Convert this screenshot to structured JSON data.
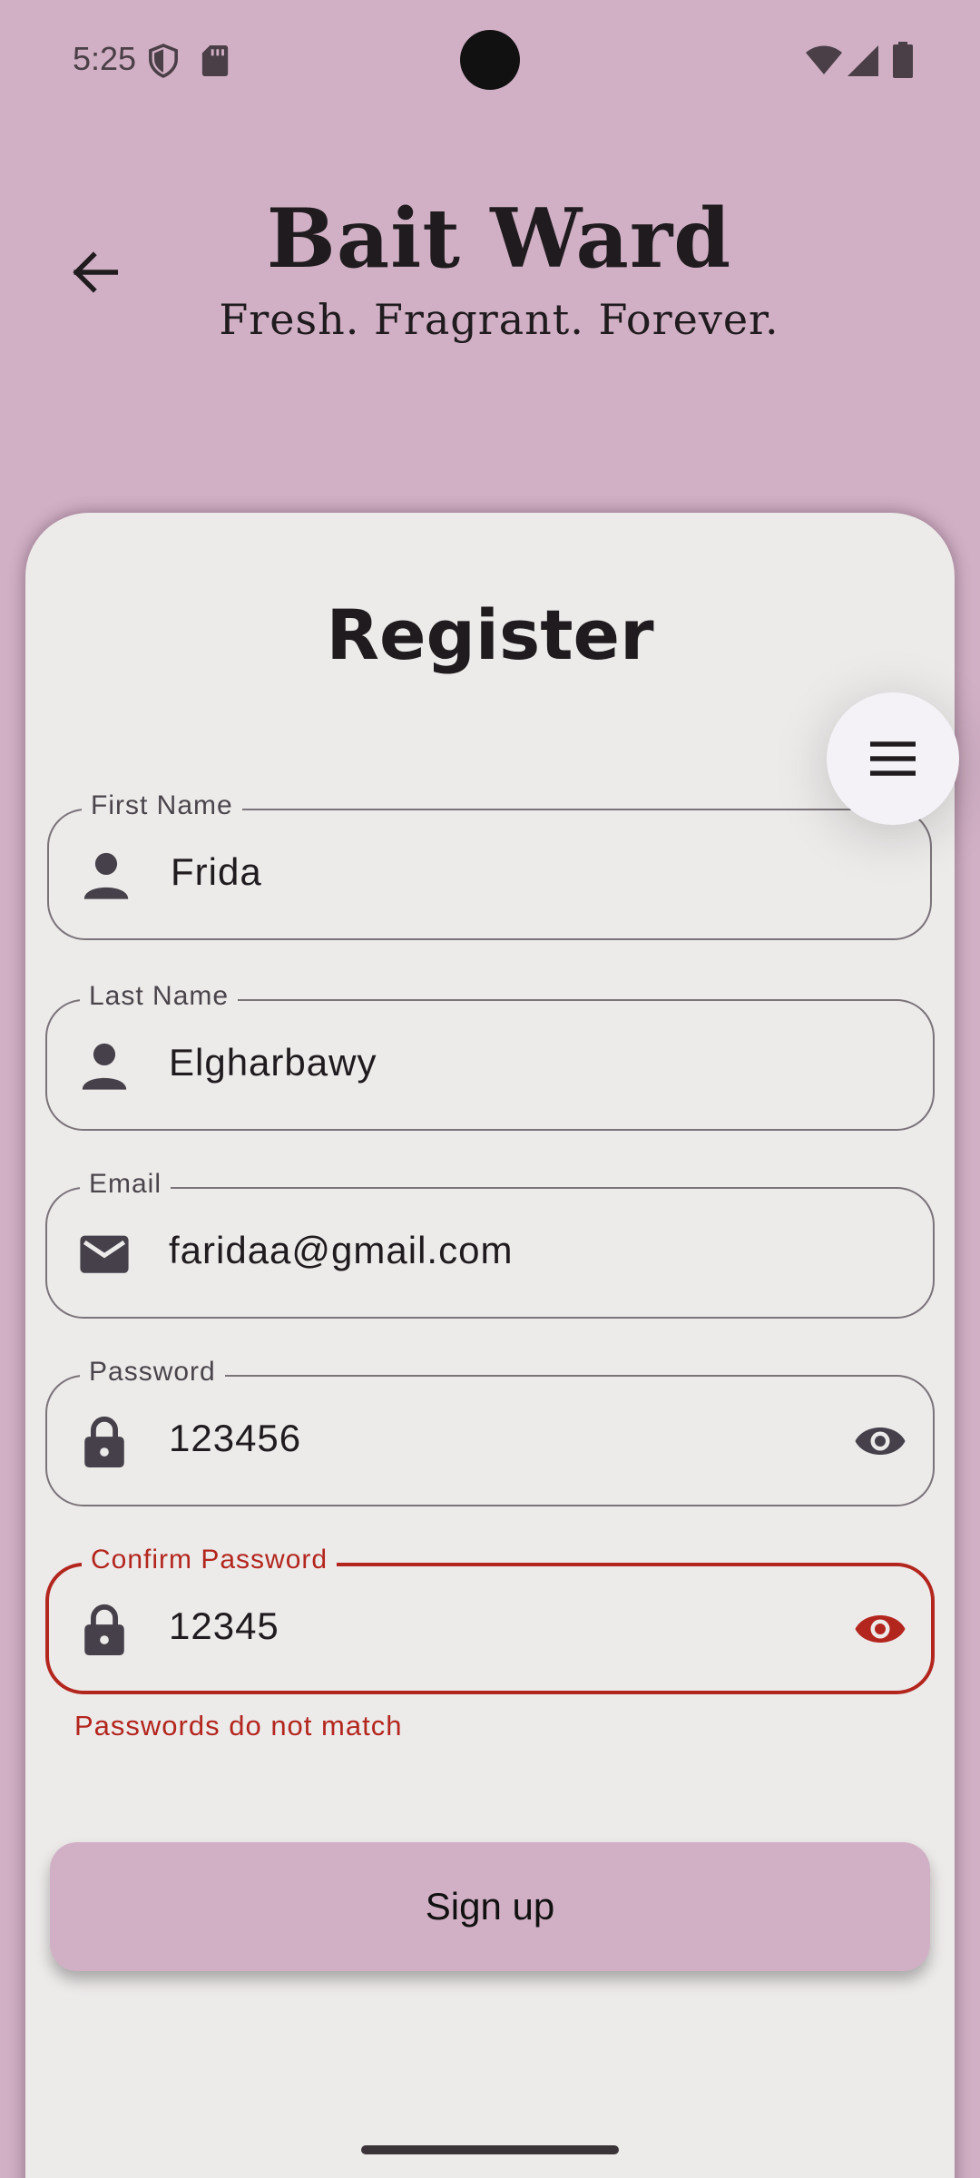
{
  "status_bar": {
    "time": "5:25",
    "icons": [
      "shield-icon",
      "sd-card-icon",
      "wifi-icon",
      "signal-icon",
      "battery-icon"
    ]
  },
  "header": {
    "back_icon": "arrow-back-icon",
    "title": "Bait Ward",
    "subtitle": "Fresh. Fragrant. Forever."
  },
  "form": {
    "title": "Register",
    "menu_icon": "menu-icon",
    "fields": [
      {
        "label": "First Name",
        "value": "Frida",
        "icon": "person-icon"
      },
      {
        "label": "Last Name",
        "value": "Elgharbawy",
        "icon": "person-icon"
      },
      {
        "label": "Email",
        "value": "faridaa@gmail.com",
        "icon": "mail-icon"
      },
      {
        "label": "Password",
        "value": "123456",
        "icon": "lock-icon",
        "trailing": "eye-icon"
      },
      {
        "label": "Confirm Password",
        "value": "12345",
        "icon": "lock-icon",
        "trailing": "eye-icon",
        "error": true
      }
    ],
    "error_message": "Passwords do not match",
    "submit_label": "Sign up"
  },
  "colors": {
    "background": "#d1b0c5",
    "card": "#edeaea",
    "error": "#b3261e",
    "text": "#1f1b1e"
  }
}
